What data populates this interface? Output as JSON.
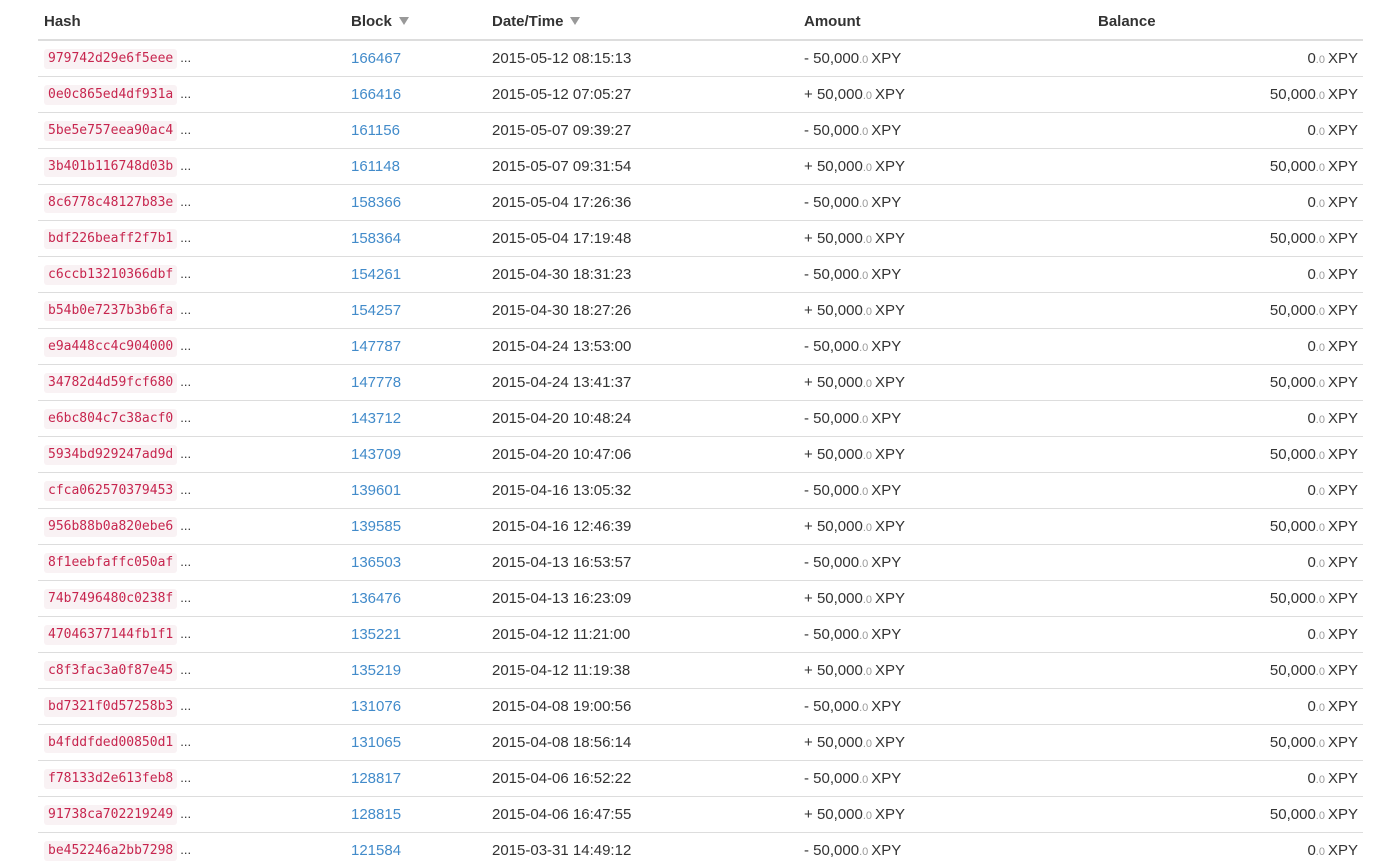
{
  "headers": {
    "hash": "Hash",
    "block": "Block",
    "datetime": "Date/Time",
    "amount": "Amount",
    "balance": "Balance"
  },
  "ellipsis": "...",
  "currency": "XPY",
  "rows": [
    {
      "hash": "979742d29e6f5eee",
      "block": "166467",
      "datetime": "2015-05-12 08:15:13",
      "amount_sign": "-",
      "amount_int": "50,000",
      "amount_dec": ".0",
      "balance_int": "0",
      "balance_dec": ".0"
    },
    {
      "hash": "0e0c865ed4df931a",
      "block": "166416",
      "datetime": "2015-05-12 07:05:27",
      "amount_sign": "+",
      "amount_int": "50,000",
      "amount_dec": ".0",
      "balance_int": "50,000",
      "balance_dec": ".0"
    },
    {
      "hash": "5be5e757eea90ac4",
      "block": "161156",
      "datetime": "2015-05-07 09:39:27",
      "amount_sign": "-",
      "amount_int": "50,000",
      "amount_dec": ".0",
      "balance_int": "0",
      "balance_dec": ".0"
    },
    {
      "hash": "3b401b116748d03b",
      "block": "161148",
      "datetime": "2015-05-07 09:31:54",
      "amount_sign": "+",
      "amount_int": "50,000",
      "amount_dec": ".0",
      "balance_int": "50,000",
      "balance_dec": ".0"
    },
    {
      "hash": "8c6778c48127b83e",
      "block": "158366",
      "datetime": "2015-05-04 17:26:36",
      "amount_sign": "-",
      "amount_int": "50,000",
      "amount_dec": ".0",
      "balance_int": "0",
      "balance_dec": ".0"
    },
    {
      "hash": "bdf226beaff2f7b1",
      "block": "158364",
      "datetime": "2015-05-04 17:19:48",
      "amount_sign": "+",
      "amount_int": "50,000",
      "amount_dec": ".0",
      "balance_int": "50,000",
      "balance_dec": ".0"
    },
    {
      "hash": "c6ccb13210366dbf",
      "block": "154261",
      "datetime": "2015-04-30 18:31:23",
      "amount_sign": "-",
      "amount_int": "50,000",
      "amount_dec": ".0",
      "balance_int": "0",
      "balance_dec": ".0"
    },
    {
      "hash": "b54b0e7237b3b6fa",
      "block": "154257",
      "datetime": "2015-04-30 18:27:26",
      "amount_sign": "+",
      "amount_int": "50,000",
      "amount_dec": ".0",
      "balance_int": "50,000",
      "balance_dec": ".0"
    },
    {
      "hash": "e9a448cc4c904000",
      "block": "147787",
      "datetime": "2015-04-24 13:53:00",
      "amount_sign": "-",
      "amount_int": "50,000",
      "amount_dec": ".0",
      "balance_int": "0",
      "balance_dec": ".0"
    },
    {
      "hash": "34782d4d59fcf680",
      "block": "147778",
      "datetime": "2015-04-24 13:41:37",
      "amount_sign": "+",
      "amount_int": "50,000",
      "amount_dec": ".0",
      "balance_int": "50,000",
      "balance_dec": ".0"
    },
    {
      "hash": "e6bc804c7c38acf0",
      "block": "143712",
      "datetime": "2015-04-20 10:48:24",
      "amount_sign": "-",
      "amount_int": "50,000",
      "amount_dec": ".0",
      "balance_int": "0",
      "balance_dec": ".0"
    },
    {
      "hash": "5934bd929247ad9d",
      "block": "143709",
      "datetime": "2015-04-20 10:47:06",
      "amount_sign": "+",
      "amount_int": "50,000",
      "amount_dec": ".0",
      "balance_int": "50,000",
      "balance_dec": ".0"
    },
    {
      "hash": "cfca062570379453",
      "block": "139601",
      "datetime": "2015-04-16 13:05:32",
      "amount_sign": "-",
      "amount_int": "50,000",
      "amount_dec": ".0",
      "balance_int": "0",
      "balance_dec": ".0"
    },
    {
      "hash": "956b88b0a820ebe6",
      "block": "139585",
      "datetime": "2015-04-16 12:46:39",
      "amount_sign": "+",
      "amount_int": "50,000",
      "amount_dec": ".0",
      "balance_int": "50,000",
      "balance_dec": ".0"
    },
    {
      "hash": "8f1eebfaffc050af",
      "block": "136503",
      "datetime": "2015-04-13 16:53:57",
      "amount_sign": "-",
      "amount_int": "50,000",
      "amount_dec": ".0",
      "balance_int": "0",
      "balance_dec": ".0"
    },
    {
      "hash": "74b7496480c0238f",
      "block": "136476",
      "datetime": "2015-04-13 16:23:09",
      "amount_sign": "+",
      "amount_int": "50,000",
      "amount_dec": ".0",
      "balance_int": "50,000",
      "balance_dec": ".0"
    },
    {
      "hash": "47046377144fb1f1",
      "block": "135221",
      "datetime": "2015-04-12 11:21:00",
      "amount_sign": "-",
      "amount_int": "50,000",
      "amount_dec": ".0",
      "balance_int": "0",
      "balance_dec": ".0"
    },
    {
      "hash": "c8f3fac3a0f87e45",
      "block": "135219",
      "datetime": "2015-04-12 11:19:38",
      "amount_sign": "+",
      "amount_int": "50,000",
      "amount_dec": ".0",
      "balance_int": "50,000",
      "balance_dec": ".0"
    },
    {
      "hash": "bd7321f0d57258b3",
      "block": "131076",
      "datetime": "2015-04-08 19:00:56",
      "amount_sign": "-",
      "amount_int": "50,000",
      "amount_dec": ".0",
      "balance_int": "0",
      "balance_dec": ".0"
    },
    {
      "hash": "b4fddfded00850d1",
      "block": "131065",
      "datetime": "2015-04-08 18:56:14",
      "amount_sign": "+",
      "amount_int": "50,000",
      "amount_dec": ".0",
      "balance_int": "50,000",
      "balance_dec": ".0"
    },
    {
      "hash": "f78133d2e613feb8",
      "block": "128817",
      "datetime": "2015-04-06 16:52:22",
      "amount_sign": "-",
      "amount_int": "50,000",
      "amount_dec": ".0",
      "balance_int": "0",
      "balance_dec": ".0"
    },
    {
      "hash": "91738ca702219249",
      "block": "128815",
      "datetime": "2015-04-06 16:47:55",
      "amount_sign": "+",
      "amount_int": "50,000",
      "amount_dec": ".0",
      "balance_int": "50,000",
      "balance_dec": ".0"
    },
    {
      "hash": "be452246a2bb7298",
      "block": "121584",
      "datetime": "2015-03-31 14:49:12",
      "amount_sign": "-",
      "amount_int": "50,000",
      "amount_dec": ".0",
      "balance_int": "0",
      "balance_dec": ".0"
    }
  ]
}
